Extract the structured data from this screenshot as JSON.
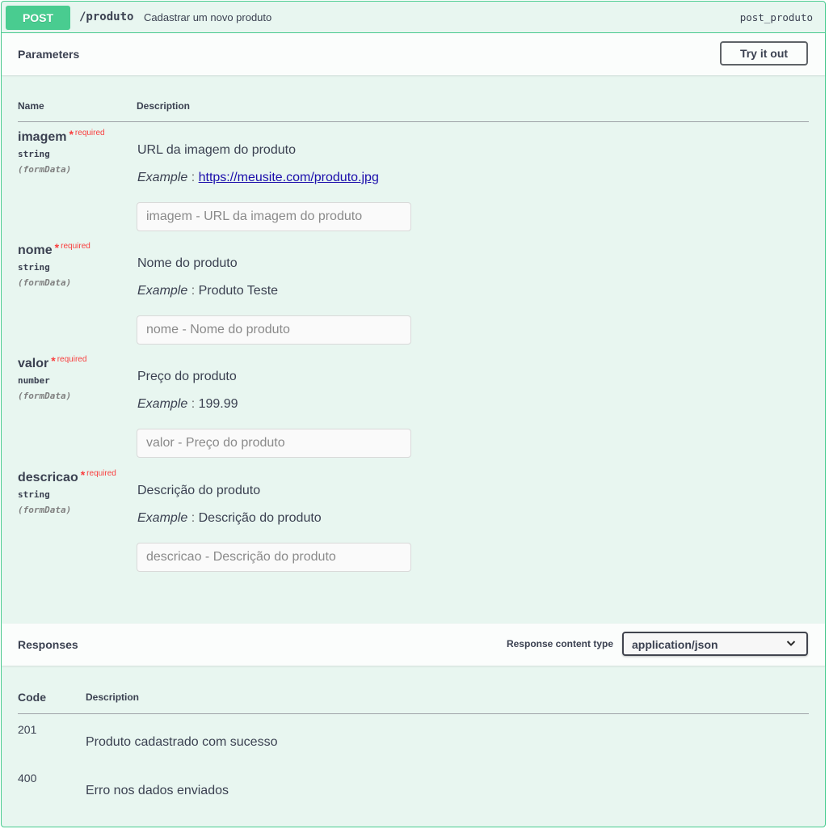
{
  "operation": {
    "method": "POST",
    "path": "/produto",
    "summary": "Cadastrar um novo produto",
    "operation_id": "post_produto"
  },
  "parameters": {
    "title": "Parameters",
    "try_label": "Try it out",
    "col_name": "Name",
    "col_description": "Description",
    "required_star": "*",
    "required_label": "required",
    "example_label": "Example",
    "example_sep": ":",
    "items": [
      {
        "name": "imagem",
        "type": "string",
        "in": "(formData)",
        "description": "URL da imagem do produto",
        "example": "https://meusite.com/produto.jpg",
        "placeholder": "imagem - URL da imagem do produto"
      },
      {
        "name": "nome",
        "type": "string",
        "in": "(formData)",
        "description": "Nome do produto",
        "example": "Produto Teste",
        "placeholder": "nome - Nome do produto"
      },
      {
        "name": "valor",
        "type": "number",
        "in": "(formData)",
        "description": "Preço do produto",
        "example": "199.99",
        "placeholder": "valor - Preço do produto"
      },
      {
        "name": "descricao",
        "type": "string",
        "in": "(formData)",
        "description": "Descrição do produto",
        "example": "Descrição do produto",
        "placeholder": "descricao - Descrição do produto"
      }
    ]
  },
  "responses": {
    "title": "Responses",
    "content_type_label": "Response content type",
    "content_type_value": "application/json",
    "col_code": "Code",
    "col_description": "Description",
    "items": [
      {
        "code": "201",
        "description": "Produto cadastrado com sucesso"
      },
      {
        "code": "400",
        "description": "Erro nos dados enviados"
      }
    ]
  },
  "colors": {
    "post_accent": "#49cc90",
    "block_background": "#e8f6f0",
    "required": "#f93e3e",
    "link": "#1a0dab"
  }
}
